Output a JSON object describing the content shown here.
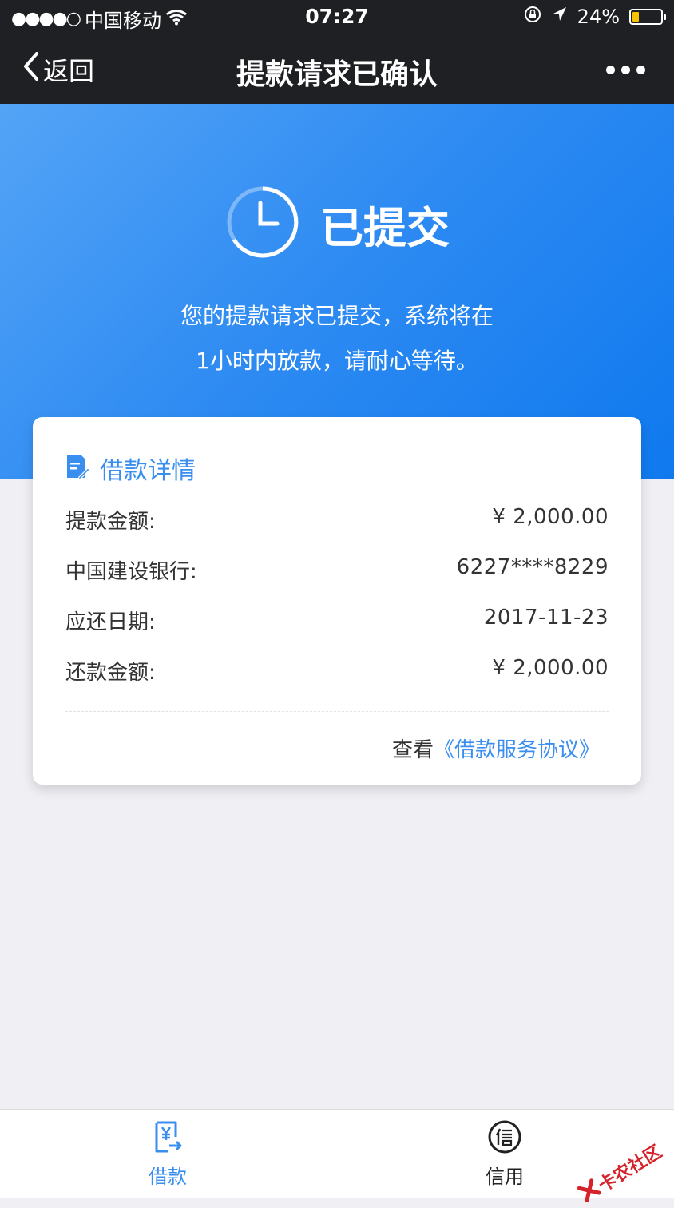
{
  "status_bar": {
    "signal_dots": "●●●●○",
    "carrier": "中国移动",
    "wifi_icon": "wifi-icon",
    "time": "07:27",
    "battery_percent": "24%",
    "battery_level": 0.24
  },
  "nav": {
    "back_label": "返回",
    "title": "提款请求已确认"
  },
  "hero": {
    "status_title": "已提交",
    "desc_line1": "您的提款请求已提交，系统将在",
    "desc_line2": "1小时内放款，请耐心等待。"
  },
  "details": {
    "title": "借款详情",
    "rows": [
      {
        "label": "提款金额:",
        "value": "¥ 2,000.00"
      },
      {
        "label": "中国建设银行:",
        "value": "6227****8229"
      },
      {
        "label": "应还日期:",
        "value": "2017-11-23"
      },
      {
        "label": "还款金额:",
        "value": "¥ 2,000.00"
      }
    ],
    "agreement_prefix": "查看",
    "agreement_link": "《借款服务协议》"
  },
  "tabs": [
    {
      "label": "借款",
      "icon": "loan-icon"
    },
    {
      "label": "信用",
      "icon": "credit-icon"
    }
  ],
  "watermark": {
    "text": "卡农社区"
  },
  "colors": {
    "accent": "#3a8ef0",
    "topbar": "#1f2023",
    "hero_start": "#53a4f6",
    "hero_end": "#0f79ee",
    "background": "#efeff4",
    "battery": "#f7c300"
  }
}
